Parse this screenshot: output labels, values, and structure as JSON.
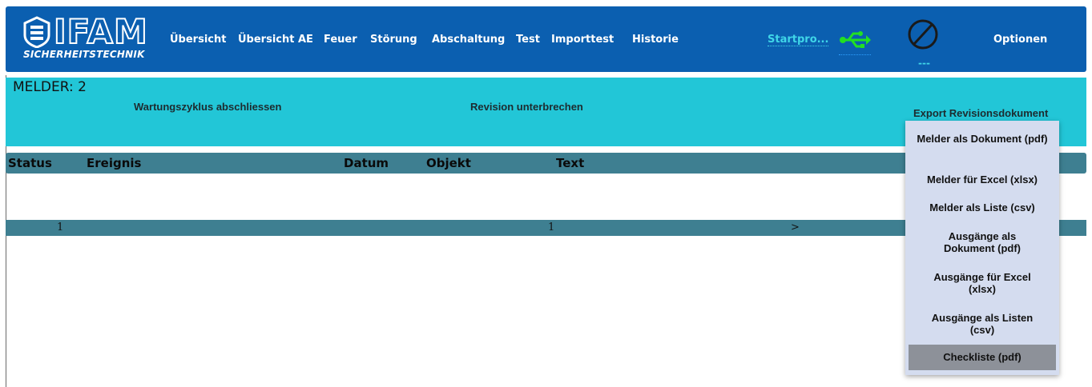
{
  "header": {
    "logo_word": "IFAM",
    "logo_sub": "SICHERHEITSTECHNIK",
    "nav": [
      "Übersicht",
      "Übersicht AE",
      "Feuer",
      "Störung",
      "Abschaltung",
      "Test",
      "Importtest",
      "Historie"
    ],
    "start": "Startpro...",
    "usb_icon": "usb-icon",
    "status_icon": "no-entry-icon",
    "status_text": "---",
    "options": "Optionen"
  },
  "panel": {
    "title": "MELDER: 2",
    "wartung": "Wartungszyklus abschliessen",
    "revision": "Revision unterbrechen",
    "export": "Export Revisionsdokument"
  },
  "table": {
    "columns": [
      "Status",
      "Ereignis",
      "Datum",
      "Objekt",
      "Text"
    ]
  },
  "pager": {
    "first": "1",
    "current": "1",
    "next": ">"
  },
  "export_menu": {
    "items": [
      "Melder als Dokument (pdf)",
      "Melder für Excel (xlsx)",
      "Melder als Liste (csv)",
      "Ausgänge als Dokument (pdf)",
      "Ausgänge für Excel (xlsx)",
      "Ausgänge als Listen (csv)",
      "Checkliste (pdf)"
    ],
    "active_index": 6
  },
  "colors": {
    "header": "#0b5fb0",
    "panel": "#22c6d7",
    "table_header": "#3e7f91",
    "menu": "#d4dcef",
    "menu_active": "#8d9199",
    "usb": "#22e022"
  }
}
